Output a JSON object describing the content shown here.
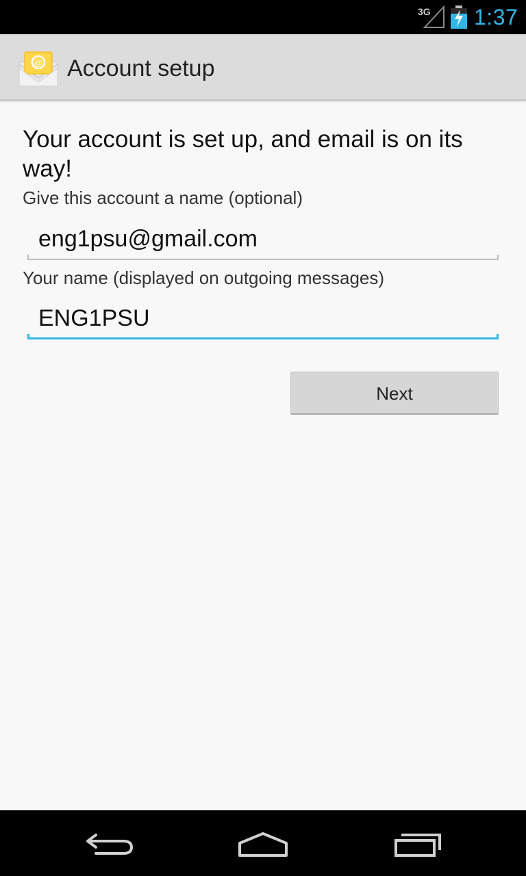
{
  "status_bar": {
    "network": "3G",
    "time": "1:37",
    "accent_color": "#33b5e5"
  },
  "action_bar": {
    "title": "Account setup",
    "icon": "email-app-icon"
  },
  "content": {
    "headline": "Your account is set up, and email is on its way!",
    "account_name_label": "Give this account a name (optional)",
    "account_name_value": "eng1psu@gmail.com",
    "your_name_label": "Your name (displayed on outgoing messages)",
    "your_name_value": "ENG1PSU",
    "next_button_label": "Next"
  },
  "nav_bar": {
    "buttons": [
      "back-icon",
      "home-icon",
      "recent-apps-icon"
    ]
  }
}
